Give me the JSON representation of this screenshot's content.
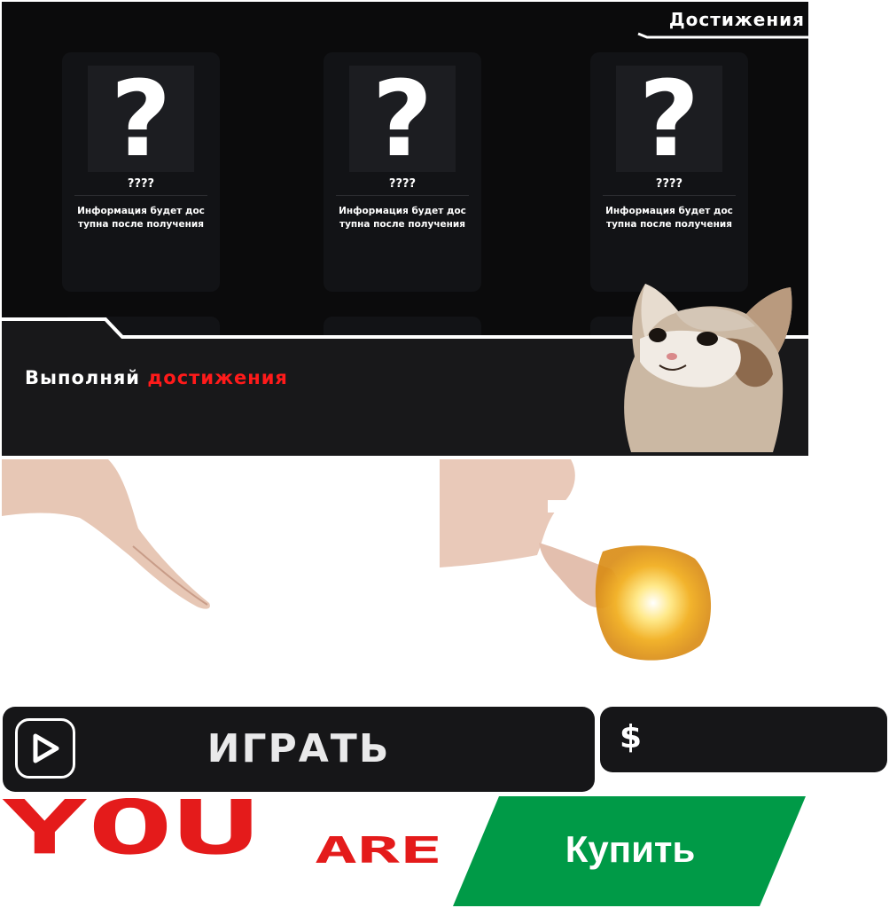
{
  "achievements": {
    "title": "Достижения",
    "cards": [
      {
        "icon": "?",
        "name": "????",
        "description": "Информация будет дос тупна после получения"
      },
      {
        "icon": "?",
        "name": "????",
        "description": "Информация будет дос тупна после получения"
      },
      {
        "icon": "?",
        "name": "????",
        "description": "Информация будет дос тупна после получения"
      }
    ],
    "promo": {
      "text": "Выполняй",
      "accent": "достижения"
    }
  },
  "play_button": {
    "label": "ИГРАТЬ",
    "icon": "play-icon"
  },
  "currency_button": {
    "symbol": "$"
  },
  "bottom": {
    "you": "YOU",
    "are": "ARE",
    "buy_label": "Купить"
  },
  "colors": {
    "accent_red": "#ff1a1a",
    "buy_green": "#009a47",
    "panel_bg": "#0b0b0c",
    "button_bg": "#161618"
  }
}
